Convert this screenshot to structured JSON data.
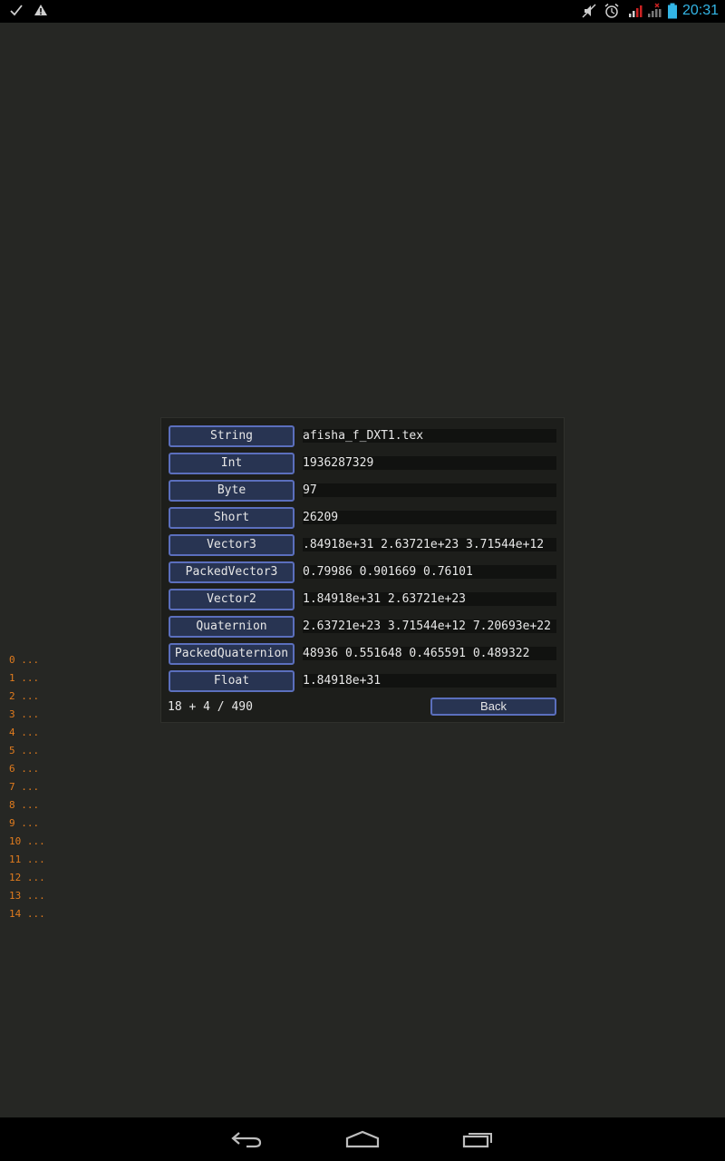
{
  "status_bar": {
    "clock": "20:31",
    "left_icons": [
      "check-icon",
      "warning-icon"
    ],
    "right_icons": [
      "mute-icon",
      "alarm-icon",
      "signal-no-data-icon",
      "signal-icon",
      "battery-icon"
    ]
  },
  "dialog": {
    "rows": [
      {
        "type": "String",
        "value": "afisha_f_DXT1.tex"
      },
      {
        "type": "Int",
        "value": "1936287329"
      },
      {
        "type": "Byte",
        "value": "97"
      },
      {
        "type": "Short",
        "value": "26209"
      },
      {
        "type": "Vector3",
        "value": ".84918e+31 2.63721e+23 3.71544e+12"
      },
      {
        "type": "PackedVector3",
        "value": "0.79986 0.901669 0.76101"
      },
      {
        "type": "Vector2",
        "value": "1.84918e+31 2.63721e+23"
      },
      {
        "type": "Quaternion",
        "value": "2.63721e+23 3.71544e+12 7.20693e+22"
      },
      {
        "type": "PackedQuaternion",
        "value": "48936 0.551648 0.465591 0.489322"
      },
      {
        "type": "Float",
        "value": "1.84918e+31"
      }
    ],
    "footer": "18 + 4 / 490",
    "back_label": "Back"
  },
  "side_list": [
    "0 ...",
    "1 ...",
    "2 ...",
    "3 ...",
    "4 ...",
    "5 ...",
    "6 ...",
    "7 ...",
    "8 ...",
    "9 ...",
    "10 ...",
    "11 ...",
    "12 ...",
    "13 ...",
    "14 ..."
  ],
  "colors": {
    "background": "#262724",
    "button_fill": "#283452",
    "button_border": "#5b6fbd",
    "list_text": "#e07b1e",
    "clock": "#33b5e5"
  },
  "nav_bar": {
    "icons": [
      "back-icon",
      "home-icon",
      "recent-apps-icon"
    ]
  }
}
